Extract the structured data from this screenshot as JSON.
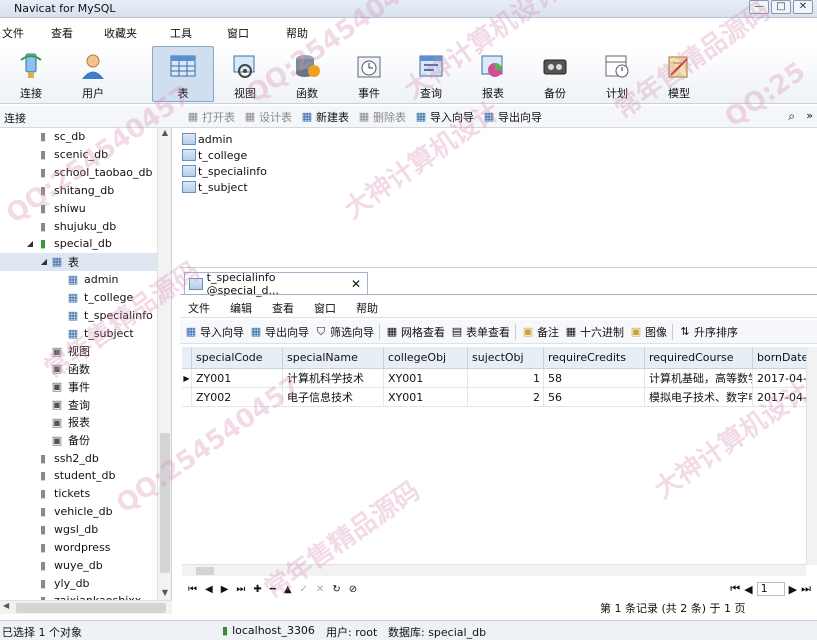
{
  "window": {
    "title": "Navicat for MySQL",
    "controls": [
      "—",
      "□",
      "✕"
    ]
  },
  "menu": [
    "文件",
    "查看",
    "收藏夹",
    "工具",
    "窗口",
    "帮助"
  ],
  "toolbar": [
    {
      "label": "连接",
      "icon": "connect-icon"
    },
    {
      "label": "用户",
      "icon": "user-icon"
    },
    {
      "label": "表",
      "icon": "table-icon",
      "active": true
    },
    {
      "label": "视图",
      "icon": "view-icon"
    },
    {
      "label": "函数",
      "icon": "function-icon"
    },
    {
      "label": "事件",
      "icon": "event-icon"
    },
    {
      "label": "查询",
      "icon": "query-icon"
    },
    {
      "label": "报表",
      "icon": "report-icon"
    },
    {
      "label": "备份",
      "icon": "backup-icon"
    },
    {
      "label": "计划",
      "icon": "schedule-icon"
    },
    {
      "label": "模型",
      "icon": "model-icon"
    }
  ],
  "subbar": {
    "connection_label": "连接",
    "actions": [
      {
        "label": "打开表",
        "disabled": true
      },
      {
        "label": "设计表",
        "disabled": true
      },
      {
        "label": "新建表",
        "disabled": false
      },
      {
        "label": "删除表",
        "disabled": true
      },
      {
        "label": "导入向导",
        "disabled": false
      },
      {
        "label": "导出向导",
        "disabled": false
      }
    ],
    "more": "»"
  },
  "tree": [
    {
      "label": "sc_db",
      "type": "db"
    },
    {
      "label": "scenic_db",
      "type": "db"
    },
    {
      "label": "school_taobao_db",
      "type": "db"
    },
    {
      "label": "shitang_db",
      "type": "db"
    },
    {
      "label": "shiwu",
      "type": "db"
    },
    {
      "label": "shujuku_db",
      "type": "db"
    },
    {
      "label": "special_db",
      "type": "db-open"
    },
    {
      "label": "表",
      "type": "folder"
    },
    {
      "label": "admin",
      "type": "table"
    },
    {
      "label": "t_college",
      "type": "table"
    },
    {
      "label": "t_specialinfo",
      "type": "table"
    },
    {
      "label": "t_subject",
      "type": "table"
    },
    {
      "label": "视图",
      "type": "sub"
    },
    {
      "label": "函数",
      "type": "sub"
    },
    {
      "label": "事件",
      "type": "sub"
    },
    {
      "label": "查询",
      "type": "sub"
    },
    {
      "label": "报表",
      "type": "sub"
    },
    {
      "label": "备份",
      "type": "sub"
    },
    {
      "label": "ssh2_db",
      "type": "db"
    },
    {
      "label": "student_db",
      "type": "db"
    },
    {
      "label": "tickets",
      "type": "db"
    },
    {
      "label": "vehicle_db",
      "type": "db"
    },
    {
      "label": "wgsl_db",
      "type": "db"
    },
    {
      "label": "wordpress",
      "type": "db"
    },
    {
      "label": "wuye_db",
      "type": "db"
    },
    {
      "label": "yly_db",
      "type": "db"
    },
    {
      "label": "zaixiankaoshixx",
      "type": "db"
    }
  ],
  "objects": [
    "admin",
    "t_college",
    "t_specialinfo",
    "t_subject"
  ],
  "doc_tab": {
    "label": "t_specialinfo @special_d...",
    "close": "✕"
  },
  "inner_menu": [
    "文件",
    "编辑",
    "查看",
    "窗口",
    "帮助"
  ],
  "inner_tools": [
    "导入向导",
    "导出向导",
    "筛选向导",
    "网格查看",
    "表单查看",
    "备注",
    "十六进制",
    "图像",
    "升序排序"
  ],
  "grid": {
    "columns": [
      "specialCode",
      "specialName",
      "collegeObj",
      "sujectObj",
      "requireCredits",
      "requiredCourse",
      "bornDate"
    ],
    "rows": [
      [
        "ZY001",
        "计算机科学技术",
        "XY001",
        "1",
        "58",
        "计算机基础，高等数学",
        "2017-04-"
      ],
      [
        "ZY002",
        "电子信息技术",
        "XY001",
        "2",
        "56",
        "模拟电子技术、数字电",
        "2017-04-"
      ]
    ]
  },
  "nav": {
    "page": "1",
    "record_status": "第 1 条记录 (共 2 条) 于 1 页"
  },
  "status": {
    "selected": "已选择 1 个对象",
    "connection": "localhost_3306",
    "user": "用户: root",
    "database": "数据库: special_db"
  },
  "watermarks": [
    "QQ:254540457",
    "大神计算机设计",
    "常年售精品源码",
    "QQ:254540457",
    "大神计算机设计",
    "常年售精品源码",
    "QQ:254540457",
    "大神计算机设计",
    "QQ:25",
    "常年售精品源码"
  ]
}
